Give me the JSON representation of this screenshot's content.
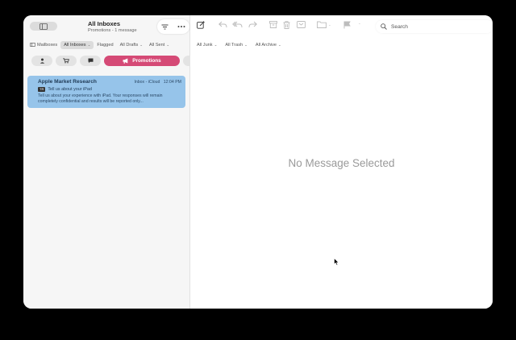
{
  "header": {
    "title": "All Inboxes",
    "subtitle": "Promotions - 1 message"
  },
  "sidebar_filters": [
    {
      "label": "Mailboxes",
      "active": false,
      "chevron": false
    },
    {
      "label": "All Inboxes",
      "active": true,
      "chevron": true
    },
    {
      "label": "Flagged",
      "active": false,
      "chevron": false
    },
    {
      "label": "All Drafts",
      "active": false,
      "chevron": true
    },
    {
      "label": "All Sent",
      "active": false,
      "chevron": true
    }
  ],
  "main_filters": [
    {
      "label": "All Junk"
    },
    {
      "label": "All Trash"
    },
    {
      "label": "All Archive"
    }
  ],
  "categories": {
    "selected_label": "Promotions",
    "selected_color": "#d54a76"
  },
  "message": {
    "from": "Apple Market Research",
    "meta": "Inbox - iCloud",
    "time": "12:04 PM",
    "tag": "TR",
    "subject": "Tell us about your iPad",
    "preview": "Tell us about your experience with iPad. Your responses will remain completely confidential and results will be reported only...",
    "highlight_color": "#96c4ea"
  },
  "search": {
    "placeholder": "Search"
  },
  "main": {
    "empty_text": "No Message Selected"
  },
  "icons": [
    "sidebar-toggle-icon",
    "filter-icon",
    "more-icon",
    "compose-icon",
    "reply-icon",
    "reply-all-icon",
    "forward-icon",
    "archive-icon",
    "trash-icon",
    "junk-icon",
    "move-folder-icon",
    "flag-icon",
    "chevron-down-icon",
    "search-icon",
    "person-icon",
    "cart-icon",
    "chat-bubble-icon",
    "megaphone-icon",
    "cursor-icon"
  ]
}
